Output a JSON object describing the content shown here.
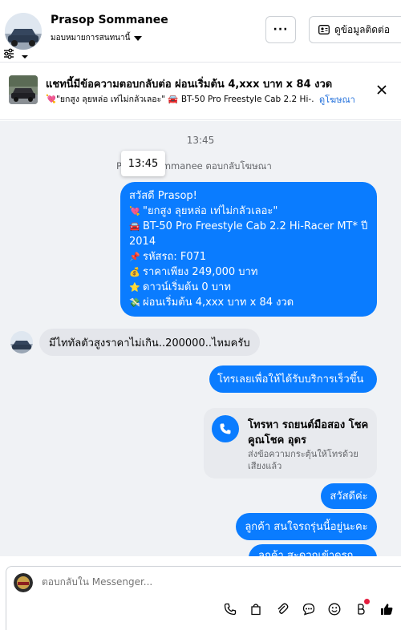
{
  "header": {
    "contact_name": "Prasop Sommanee",
    "assign_label": "มอบหมายการสนทนานี้",
    "more_label": "···",
    "view_contact_label": "ดูข้อมูลติดต่อ"
  },
  "ad_banner": {
    "title": "แชทนี้มีข้อความตอบกลับต่อ ผ่อนเริ่มต้น 4,xxx บาท x 84 งวด",
    "subtitle": "💘\"ยกสูง ลุยหล่อ เท่ไม่กลัวเลอะ\" 🚘 BT-50 Pro Freestyle Cab 2.2 Hi-…",
    "view_ad_link": "ดูโฆษณา"
  },
  "chat": {
    "timestamp": "13:45",
    "tooltip_time": "13:45",
    "replied_note": "Prasop Sommanee ตอบกลับโฆษณา",
    "ad_message": {
      "lines": [
        {
          "emoji": "",
          "text": "สวัสดี Prasop!"
        },
        {
          "emoji": "💘",
          "text": "\"ยกสูง ลุยหล่อ เท่ไม่กลัวเลอะ\""
        },
        {
          "emoji": "🚘",
          "text": "BT-50 Pro Freestyle Cab 2.2 Hi-Racer MT* ปี"
        },
        {
          "emoji": "",
          "text": "2014"
        },
        {
          "emoji": "📌",
          "text": "รหัสรถ: F071"
        },
        {
          "emoji": "💰",
          "text": "ราคาเพียง 249,000 บาท"
        },
        {
          "emoji": "⭐",
          "text": "ดาวน์เริ่มต้น 0 บาท"
        },
        {
          "emoji": "💸",
          "text": "ผ่อนเริ่มต้น 4,xxx บาท x 84 งวด"
        }
      ]
    },
    "incoming_message": "มีไททัลตัวสูงราคาไม่เกิน..200000..ไหมครับ",
    "call_prompt_message": "โทรเลยเพื่อให้ได้รับบริการเร็วขึ้น",
    "call_card": {
      "title": "โทรหา รถยนต์มือสอง โชคคูณโชค อุดร",
      "subtitle": "ส่งข้อความกระตุ้นให้โทรด้วยเสียงแล้ว"
    },
    "hello_message": "สวัสดีค่ะ",
    "customer_message": "ลูกค้า สนใจรถรุ่นนี้อยู่นะคะ",
    "cut_message": "ลูกค้า สะดวกเข้าดูรถ..."
  },
  "composer": {
    "placeholder": "ตอบกลับใน Messenger..."
  },
  "colors": {
    "accent_blue": "#0a7cff",
    "link_blue": "#216fdb",
    "chat_background": "#f0f2f5",
    "incoming_bubble": "#e4e6eb",
    "notify_red": "#e41e3f"
  }
}
